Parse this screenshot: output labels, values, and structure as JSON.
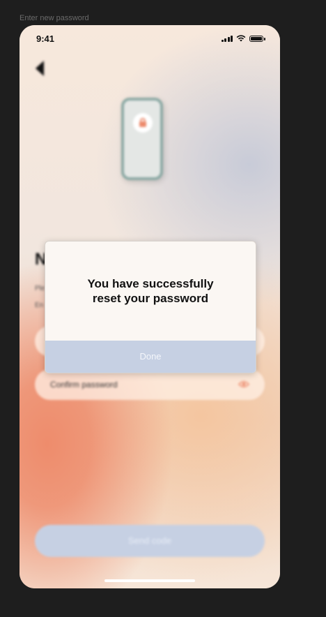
{
  "frame_label": "Enter new password",
  "status_bar": {
    "time": "9:41"
  },
  "background_screen": {
    "title": "N",
    "description_line1": "Ple",
    "description_line2": "En",
    "new_password_field": {
      "placeholder": ""
    },
    "confirm_password_field": {
      "placeholder": "Confirm password"
    },
    "send_button_label": "Send code"
  },
  "dialog": {
    "message_line1": "You have successfully",
    "message_line2": "reset your password",
    "done_label": "Done"
  },
  "colors": {
    "accent_coral": "#ec8a6c",
    "button_blue": "#c6d0e3"
  },
  "icons": {
    "back": "back-arrow-icon",
    "eye": "eye-icon",
    "lock": "lock-icon"
  }
}
